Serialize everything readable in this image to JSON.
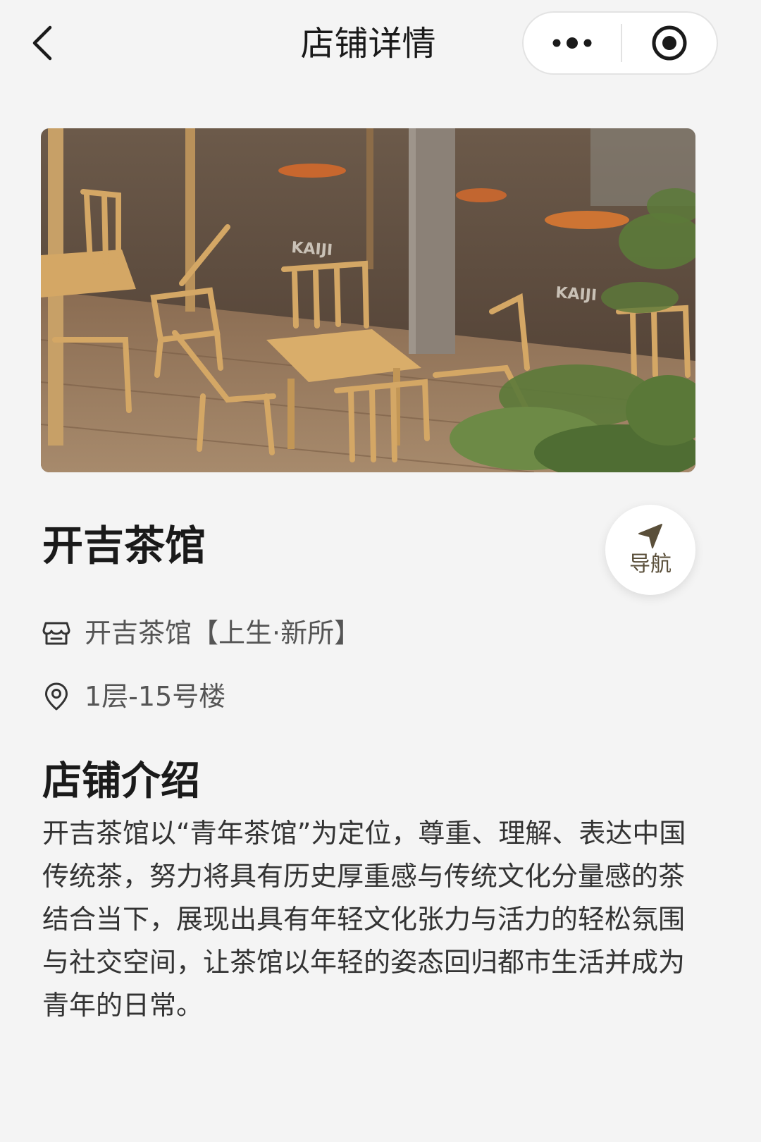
{
  "header": {
    "title": "店铺详情",
    "back_icon": "chevron-left-icon",
    "more_icon": "more-dots-icon",
    "close_icon": "target-circle-icon"
  },
  "hero": {
    "alt": "KAIJI",
    "sign_text_1": "KAIJI",
    "sign_text_2": "KAIJI"
  },
  "store": {
    "name": "开吉茶馆",
    "navigate_label": "导航",
    "navigate_icon": "navigation-arrow-icon",
    "shop_icon": "store-icon",
    "shop_full_name": "开吉茶馆【上生·新所】",
    "location_icon": "location-pin-icon",
    "address": "1层-15号楼"
  },
  "intro": {
    "title": "店铺介绍",
    "text": "开吉茶馆以“青年茶馆”为定位，尊重、理解、表达中国传统茶，努力将具有历史厚重感与传统文化分量感的茶结合当下，展现出具有年轻文化张力与活力的轻松氛围与社交空间，让茶馆以年轻的姿态回归都市生活并成为青年的日常。"
  },
  "colors": {
    "background": "#f4f4f4",
    "accent": "#5a4f3a",
    "text_primary": "#1a1a1a",
    "text_secondary": "#555555"
  }
}
